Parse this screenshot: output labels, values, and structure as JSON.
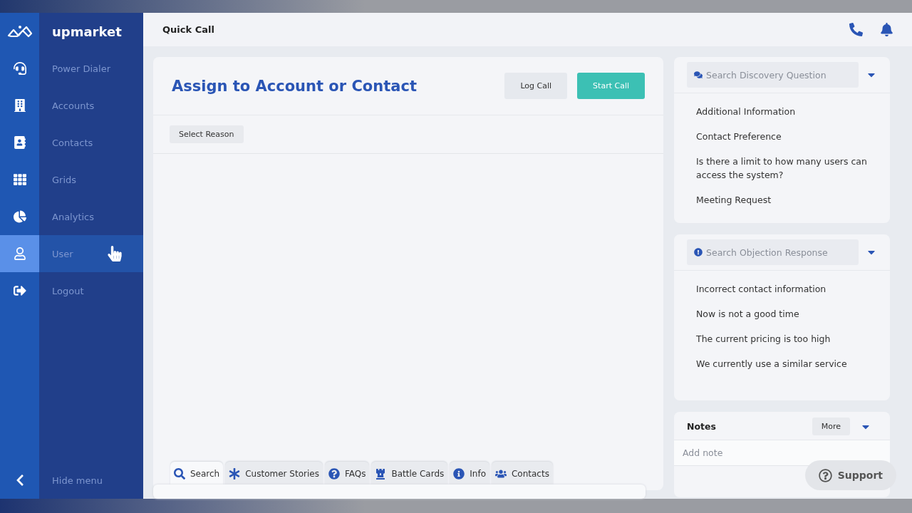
{
  "sidebar": {
    "logo": "upmarket",
    "items": [
      {
        "label": "Power Dialer",
        "selected": false
      },
      {
        "label": "Accounts",
        "selected": false
      },
      {
        "label": "Contacts",
        "selected": false
      },
      {
        "label": "Grids",
        "selected": false
      },
      {
        "label": "Analytics",
        "selected": false
      },
      {
        "label": "User",
        "selected": true
      },
      {
        "label": "Logout",
        "selected": false
      }
    ],
    "hide_menu": "Hide menu"
  },
  "header": {
    "title": "Quick Call"
  },
  "assign": {
    "title": "Assign to Account or Contact",
    "buttons": [
      {
        "label": "Log Call",
        "kind": "secondary"
      },
      {
        "label": "Start Call",
        "kind": "primary"
      }
    ],
    "reason": "Select Reason",
    "tabs": [
      {
        "label": "Search",
        "selected": true
      },
      {
        "label": "Customer Stories",
        "selected": false
      },
      {
        "label": "FAQs",
        "selected": false
      },
      {
        "label": "Battle Cards",
        "selected": false
      },
      {
        "label": "Info",
        "selected": false
      },
      {
        "label": "Contacts",
        "selected": false
      }
    ]
  },
  "discovery": {
    "placeholder": "Search Discovery Question",
    "items": [
      "Additional Information",
      "Contact Preference",
      "Is there a limit to how many users can access the system?",
      "Meeting Request"
    ]
  },
  "objection": {
    "placeholder": "Search Objection Response",
    "items": [
      "Incorrect contact information",
      "Now is not a good time",
      "The current pricing is too high",
      "We currently use a similar service"
    ]
  },
  "notes": {
    "title": "Notes",
    "more": "More",
    "placeholder": "Add note"
  },
  "support": "Support"
}
